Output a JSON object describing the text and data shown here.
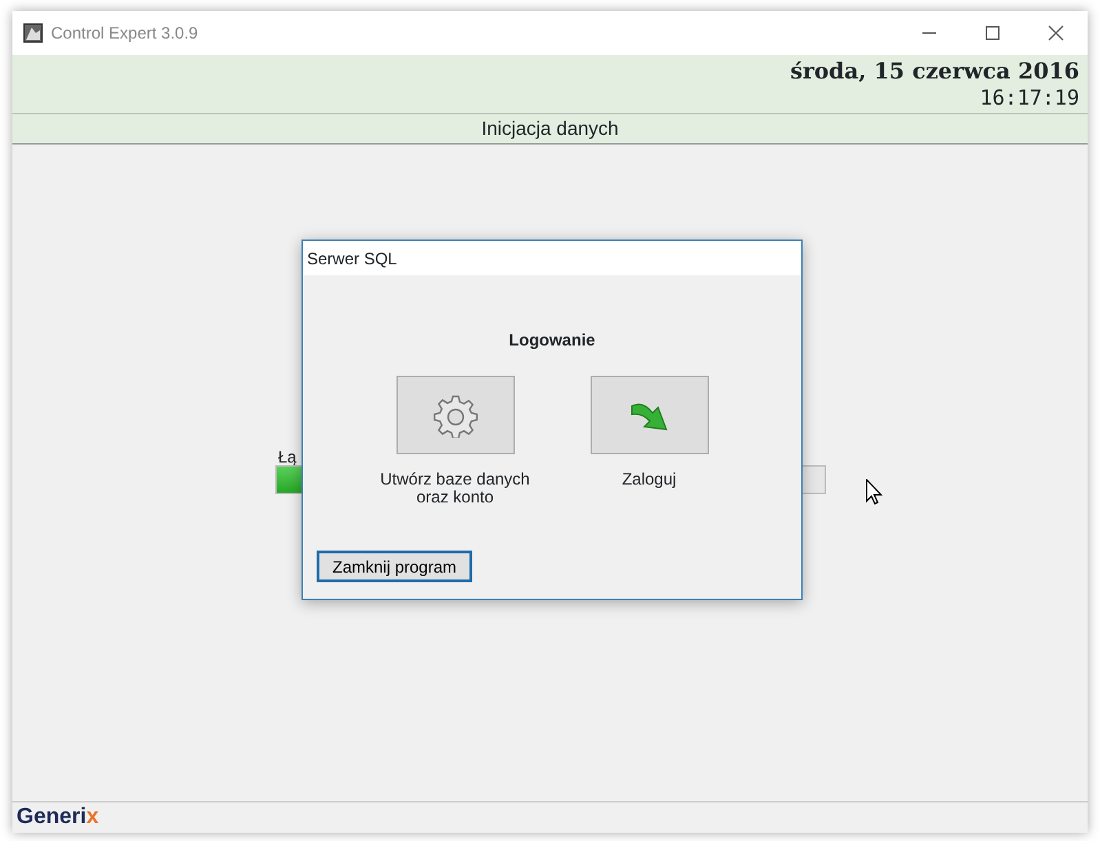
{
  "window": {
    "title": "Control Expert 3.0.9"
  },
  "header": {
    "date": "środa, 15 czerwca 2016",
    "time": "16:17:19"
  },
  "section_title": "Inicjacja danych",
  "background_progress": {
    "label": "Łą",
    "level": 0.05
  },
  "dialog": {
    "title": "Serwer SQL",
    "heading": "Logowanie",
    "actions": [
      {
        "kind": "gear",
        "label": "Utwórz baze danych\noraz konto"
      },
      {
        "kind": "arrow",
        "label": "Zaloguj"
      }
    ],
    "close_button": "Zamknij program"
  },
  "footer": {
    "logo": "Generi",
    "logo_accent": "x"
  }
}
